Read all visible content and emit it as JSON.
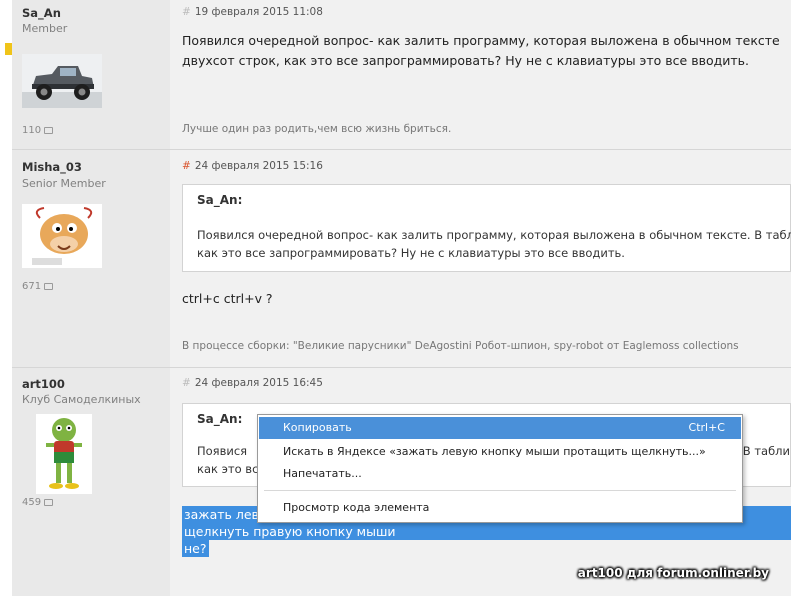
{
  "posts": [
    {
      "username": "Sa_An",
      "rank": "Member",
      "post_count": "110",
      "date": "19 февраля 2015 11:08",
      "message_lines": [
        "Появился очередной вопрос- как залить программу, которая выложена в обычном тексте",
        "двухсот строк, как это все запрограммировать? Ну не с клавиатуры это все вводить."
      ],
      "signature": "Лучше один раз родить,чем всю жизнь бриться."
    },
    {
      "username": "Misha_03",
      "rank": "Senior Member",
      "post_count": "671",
      "date": "24 февраля 2015 15:16",
      "quote_author": "Sa_An:",
      "quote_lines": [
        "Появился очередной вопрос- как залить программу, которая выложена в обычном тексте. В табли",
        "как это все запрограммировать? Ну не с клавиатуры это все вводить."
      ],
      "message": "ctrl+c ctrl+v ?",
      "signature": "В процессе сборки: \"Великие парусники\" DeAgostini Робот-шпион, spy-robot от Eaglemoss collections"
    },
    {
      "username": "art100",
      "rank": "Клуб Самоделкиных",
      "post_count": "459",
      "date": "24 февраля 2015 16:45",
      "quote_author": "Sa_An:",
      "quote_line1_start": "Появися",
      "quote_line1_end": ". В табли",
      "quote_line2_start": "как это вс",
      "selected_lines": [
        "зажать лев",
        "щелкнуть правую кнопку мыши",
        "не?"
      ]
    }
  ],
  "context_menu": {
    "items": [
      {
        "label": "Копировать",
        "shortcut": "Ctrl+C"
      },
      {
        "label": "Искать в Яндексе «зажать левую кнопку мыши протащить щелкнуть...»"
      },
      {
        "label": "Напечатать..."
      },
      {
        "label": "Просмотр кода элемента"
      }
    ]
  },
  "watermark": "art100 для forum.onliner.by",
  "colors": {
    "selection": "#3e8fe0",
    "menu_highlight": "#4a90d9",
    "hash_red": "#d9532c"
  }
}
